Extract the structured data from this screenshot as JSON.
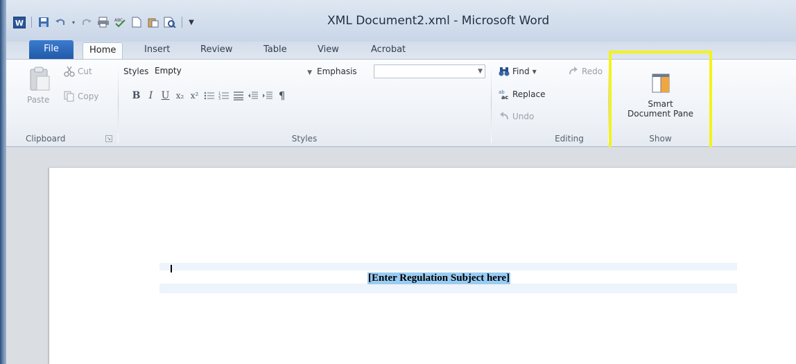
{
  "window": {
    "title": "XML Document2.xml  -  Microsoft Word"
  },
  "quick_access": [
    {
      "icon": "word-logo-icon",
      "label": "W"
    },
    {
      "icon": "save-icon"
    },
    {
      "icon": "undo-icon"
    },
    {
      "icon": "redo-icon"
    },
    {
      "icon": "print-icon"
    },
    {
      "icon": "spelling-icon"
    },
    {
      "icon": "new-document-icon"
    },
    {
      "icon": "paste-icon"
    },
    {
      "icon": "print-preview-icon"
    },
    {
      "icon": "customize-qat-icon"
    }
  ],
  "tabs": [
    "File",
    "Home",
    "Insert",
    "Review",
    "Table",
    "View",
    "Acrobat"
  ],
  "active_tab": "Home",
  "clipboard": {
    "paste": "Paste",
    "cut": "Cut",
    "copy": "Copy",
    "label": "Clipboard"
  },
  "styles": {
    "styles_label": "Styles",
    "styles_value": "Empty",
    "emphasis_label": "Emphasis",
    "emphasis_value": "",
    "group_label": "Styles",
    "format_buttons": [
      "B",
      "I",
      "U",
      "x₂",
      "x²",
      "list",
      "numlist",
      "justify",
      "outdent",
      "indent",
      "¶"
    ]
  },
  "editing": {
    "find": "Find",
    "redo": "Redo",
    "replace": "Replace",
    "undo": "Undo",
    "label": "Editing"
  },
  "show": {
    "smart_pane_line1": "Smart",
    "smart_pane_line2": "Document Pane",
    "label": "Show"
  },
  "document": {
    "placeholder": "[Enter Regulation Subject here]"
  },
  "colors": {
    "highlight_box": "#f4f21a",
    "file_tab": "#2a63b6",
    "selection": "#99ccf3"
  }
}
